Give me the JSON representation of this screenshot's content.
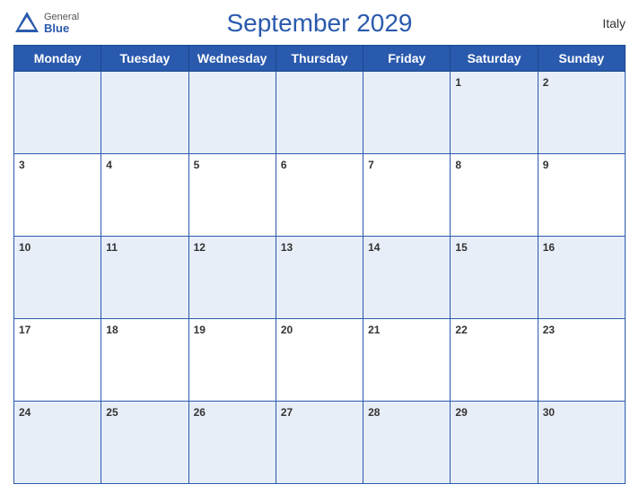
{
  "header": {
    "title": "September 2029",
    "country": "Italy",
    "logo": {
      "general": "General",
      "blue": "Blue"
    }
  },
  "days_of_week": [
    "Monday",
    "Tuesday",
    "Wednesday",
    "Thursday",
    "Friday",
    "Saturday",
    "Sunday"
  ],
  "weeks": [
    [
      null,
      null,
      null,
      null,
      null,
      1,
      2
    ],
    [
      3,
      4,
      5,
      6,
      7,
      8,
      9
    ],
    [
      10,
      11,
      12,
      13,
      14,
      15,
      16
    ],
    [
      17,
      18,
      19,
      20,
      21,
      22,
      23
    ],
    [
      24,
      25,
      26,
      27,
      28,
      29,
      30
    ]
  ]
}
